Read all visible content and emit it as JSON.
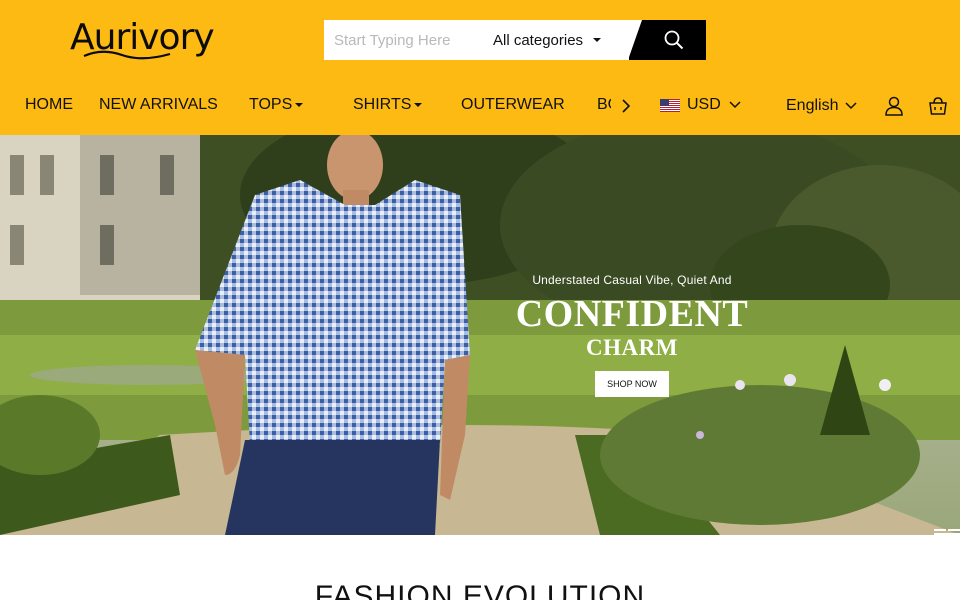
{
  "brand": {
    "name": "Aurivory"
  },
  "search": {
    "placeholder": "Start Typing Here",
    "category": "All categories"
  },
  "nav": {
    "items": [
      {
        "label": "HOME"
      },
      {
        "label": "NEW ARRIVALS"
      },
      {
        "label": "TOPS"
      },
      {
        "label": "SHIRTS"
      },
      {
        "label": "OUTERWEAR"
      },
      {
        "label": "BO"
      }
    ]
  },
  "currency": {
    "code": "USD"
  },
  "language": {
    "label": "English"
  },
  "hero": {
    "subtitle": "Understated Casual Vibe, Quiet And",
    "title": "CONFIDENT",
    "title2": "CHARM",
    "cta": "SHOP NOW"
  },
  "section": {
    "title": "FASHION EVOLUTION"
  },
  "colors": {
    "header_bg": "#FDBA12",
    "search_button": "#000000"
  },
  "icons": [
    "search-icon",
    "chevron-right-icon",
    "us-flag-icon",
    "chevron-down-icon",
    "user-icon",
    "cart-icon"
  ]
}
